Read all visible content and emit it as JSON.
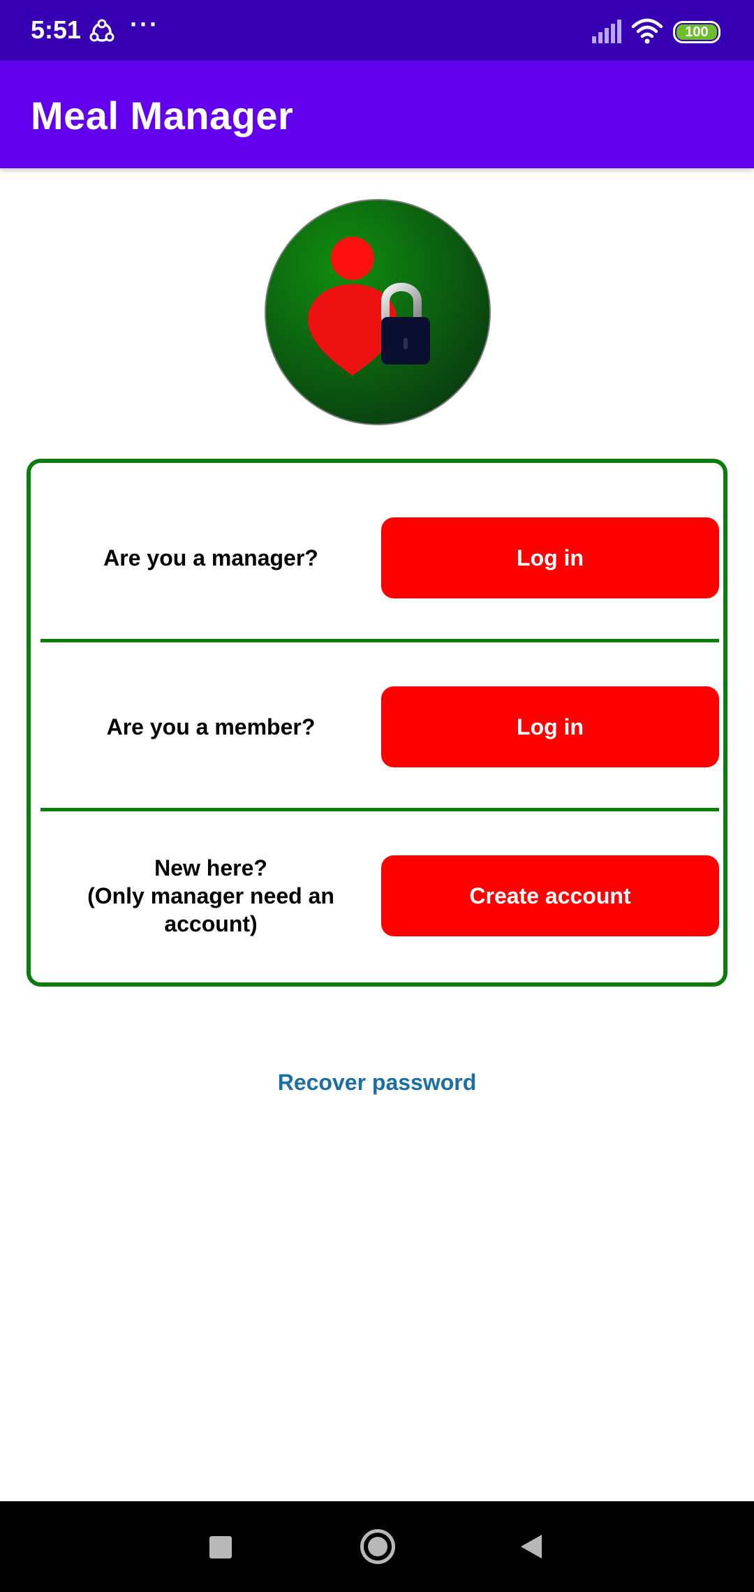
{
  "status_bar": {
    "time": "5:51",
    "more": "···",
    "battery_level": "100",
    "icons": [
      "sync-icon",
      "more-icon",
      "signal-icon",
      "wifi-icon",
      "battery-icon"
    ]
  },
  "app_bar": {
    "title": "Meal Manager"
  },
  "logo": {
    "icon": "user-lock-icon"
  },
  "card": {
    "rows": [
      {
        "label": "Are you a manager?",
        "button": "Log in"
      },
      {
        "label": "Are you a member?",
        "button": "Log in"
      },
      {
        "label": "New here?\n(Only manager need an account)",
        "button": "Create account"
      }
    ]
  },
  "recover_link": "Recover password",
  "nav_bar": {
    "icons": [
      "recents-icon",
      "home-icon",
      "back-icon"
    ]
  },
  "colors": {
    "status_bar": "#3700b3",
    "app_bar": "#6200ee",
    "card_border": "#0b7d0b",
    "button": "#ff0000",
    "link": "#1a6fa8"
  }
}
